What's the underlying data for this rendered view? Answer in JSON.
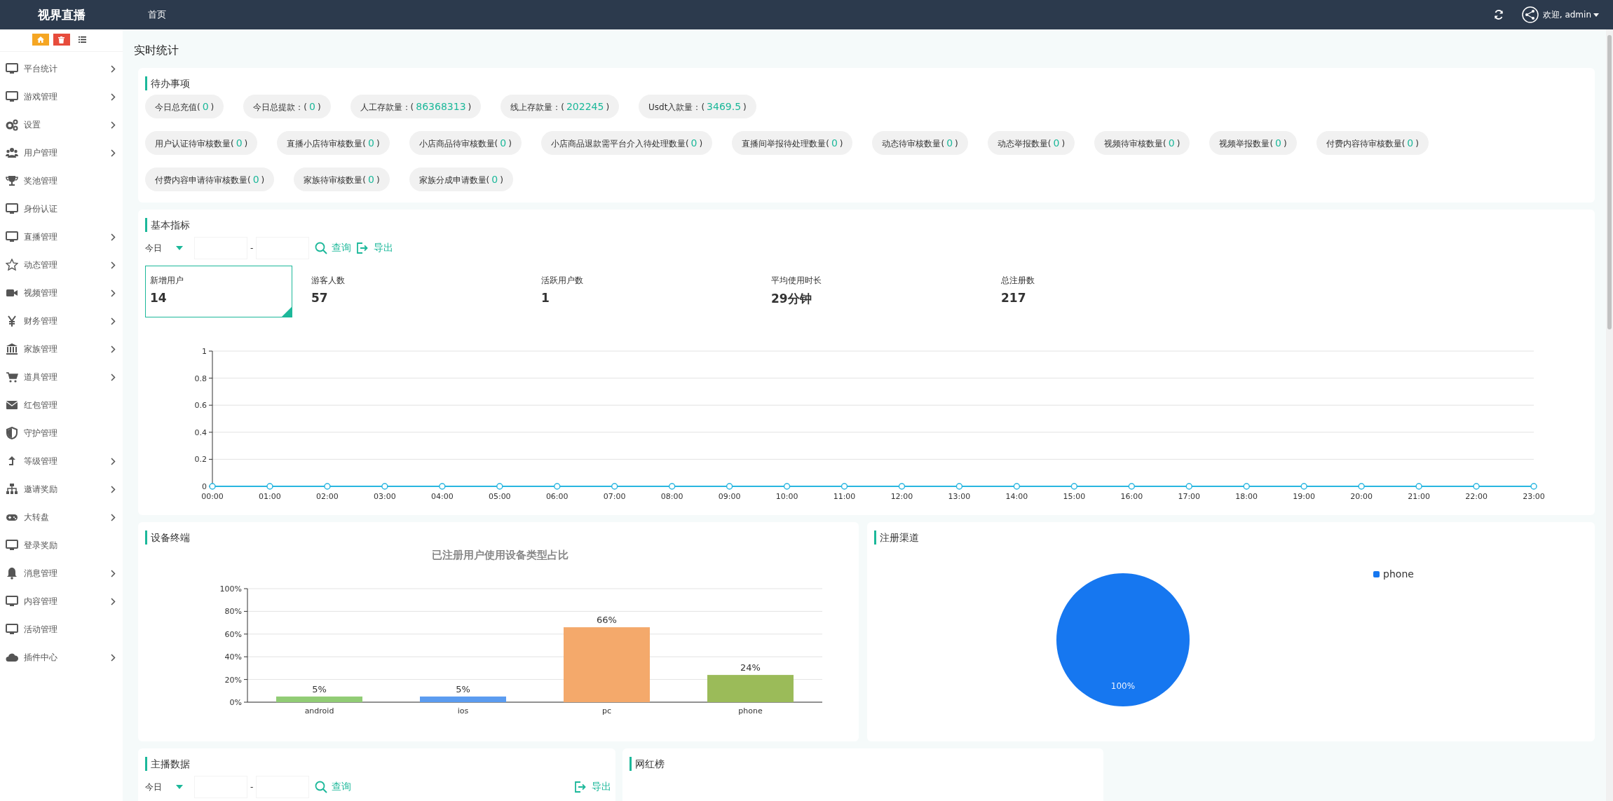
{
  "topbar": {
    "brand": "视界直播",
    "nav": [
      {
        "label": "首页",
        "selected": false
      }
    ],
    "user": "欢迎, admin"
  },
  "sidebar": {
    "items": [
      {
        "label": "平台统计",
        "has_submenu": true
      },
      {
        "label": "游戏管理",
        "has_submenu": true
      },
      {
        "label": "设置",
        "has_submenu": true
      },
      {
        "label": "用户管理",
        "has_submenu": true
      },
      {
        "label": "奖池管理",
        "has_submenu": false
      },
      {
        "label": "身份认证",
        "has_submenu": false
      },
      {
        "label": "直播管理",
        "has_submenu": true
      },
      {
        "label": "动态管理",
        "has_submenu": true
      },
      {
        "label": "视频管理",
        "has_submenu": true
      },
      {
        "label": "财务管理",
        "has_submenu": true
      },
      {
        "label": "家族管理",
        "has_submenu": true
      },
      {
        "label": "道具管理",
        "has_submenu": true
      },
      {
        "label": "红包管理",
        "has_submenu": false
      },
      {
        "label": "守护管理",
        "has_submenu": false
      },
      {
        "label": "等级管理",
        "has_submenu": true
      },
      {
        "label": "邀请奖励",
        "has_submenu": true
      },
      {
        "label": "大转盘",
        "has_submenu": true
      },
      {
        "label": "登录奖励",
        "has_submenu": false
      },
      {
        "label": "消息管理",
        "has_submenu": true
      },
      {
        "label": "内容管理",
        "has_submenu": true
      },
      {
        "label": "活动管理",
        "has_submenu": false
      },
      {
        "label": "插件中心",
        "has_submenu": true
      }
    ]
  },
  "page_title": "实时统计",
  "todo": {
    "title": "待办事项",
    "rows": [
      [
        {
          "label": "今日总充值(",
          "value": "0",
          "close": ")"
        },
        {
          "label": "今日总提款：(",
          "value": "0",
          "close": ")"
        },
        {
          "label": "人工存款量：(",
          "value": "86368313",
          "close": ")"
        },
        {
          "label": "线上存款量：(",
          "value": "202245",
          "close": ")"
        },
        {
          "label": "Usdt入款量：(",
          "value": "3469.5",
          "close": ")"
        }
      ],
      [
        {
          "label": "用户认证待审核数量(",
          "value": "0",
          "close": ")"
        },
        {
          "label": "直播小店待审核数量(",
          "value": "0",
          "close": ")"
        },
        {
          "label": "小店商品待审核数量(",
          "value": "0",
          "close": ")"
        },
        {
          "label": "小店商品退款需平台介入待处理数量(",
          "value": "0",
          "close": ")"
        },
        {
          "label": "直播间举报待处理数量(",
          "value": "0",
          "close": ")"
        },
        {
          "label": "动态待审核数量(",
          "value": "0",
          "close": ")"
        },
        {
          "label": "动态举报数量(",
          "value": "0",
          "close": ")"
        },
        {
          "label": "视频待审核数量(",
          "value": "0",
          "close": ")"
        },
        {
          "label": "视频举报数量(",
          "value": "0",
          "close": ")"
        },
        {
          "label": "付费内容待审核数量(",
          "value": "0",
          "close": ")"
        }
      ],
      [
        {
          "label": "付费内容申请待审核数量(",
          "value": "0",
          "close": ")"
        },
        {
          "label": "家族待审核数量(",
          "value": "0",
          "close": ")"
        },
        {
          "label": "家族分成申请数量(",
          "value": "0",
          "close": ")"
        }
      ]
    ]
  },
  "metrics": {
    "title": "基本指标",
    "filter": {
      "period": "今日",
      "separator": "-",
      "query": "查询",
      "export": "导出"
    },
    "stats": [
      {
        "label": "新增用户",
        "value": "14",
        "selected": true
      },
      {
        "label": "游客人数",
        "value": "57",
        "selected": false
      },
      {
        "label": "活跃用户数",
        "value": "1",
        "selected": false
      },
      {
        "label": "平均使用时长",
        "value": "29分钟",
        "selected": false
      },
      {
        "label": "总注册数",
        "value": "217",
        "selected": false
      }
    ],
    "chart_data": {
      "type": "line",
      "categories": [
        "00:00",
        "01:00",
        "02:00",
        "03:00",
        "04:00",
        "05:00",
        "06:00",
        "07:00",
        "08:00",
        "09:00",
        "10:00",
        "11:00",
        "12:00",
        "13:00",
        "14:00",
        "15:00",
        "16:00",
        "17:00",
        "18:00",
        "19:00",
        "20:00",
        "21:00",
        "22:00",
        "23:00"
      ],
      "series": [
        {
          "color": "#29b6e0",
          "values": [
            0,
            0,
            0,
            0,
            0,
            0,
            0,
            0,
            0,
            0,
            0,
            0,
            0,
            0,
            0,
            0,
            0,
            0,
            0,
            0,
            0,
            0,
            0,
            0
          ],
          "marker": true
        }
      ],
      "ylim": [
        0,
        1
      ],
      "yticks": [
        0,
        0.2,
        0.4,
        0.6,
        0.8,
        1
      ],
      "grid": true
    }
  },
  "devices": {
    "title": "设备终端",
    "chart_data": {
      "type": "bar",
      "title": "已注册用户使用设备类型占比",
      "categories": [
        "android",
        "ios",
        "pc",
        "phone"
      ],
      "series": [
        {
          "values": [
            5,
            5,
            66,
            24
          ]
        }
      ],
      "colors": [
        "#91cc75",
        "#5b9cf0",
        "#f4a96b",
        "#9bbb59"
      ],
      "ylim": [
        0,
        100
      ],
      "yticks": [
        {
          "value": 0,
          "label": "0%"
        },
        {
          "value": 20,
          "label": "20%"
        },
        {
          "value": 40,
          "label": "40%"
        },
        {
          "value": 60,
          "label": "60%"
        },
        {
          "value": 80,
          "label": "80%"
        },
        {
          "value": 100,
          "label": "100%"
        }
      ],
      "grid": true,
      "value_labels": [
        "5%",
        "5%",
        "66%",
        "24%"
      ]
    }
  },
  "channels": {
    "title": "注册渠道",
    "chart_data": {
      "type": "pie",
      "categories": [
        "phone"
      ],
      "series": [
        {
          "color": "#1677f0",
          "values": [
            100
          ]
        }
      ],
      "value_labels": [
        "100%"
      ]
    }
  },
  "anchors": {
    "title": "主播数据",
    "filter": {
      "period": "今日",
      "separator": "-",
      "query": "查询",
      "export": "导出"
    }
  },
  "ranking": {
    "title": "网红榜"
  }
}
